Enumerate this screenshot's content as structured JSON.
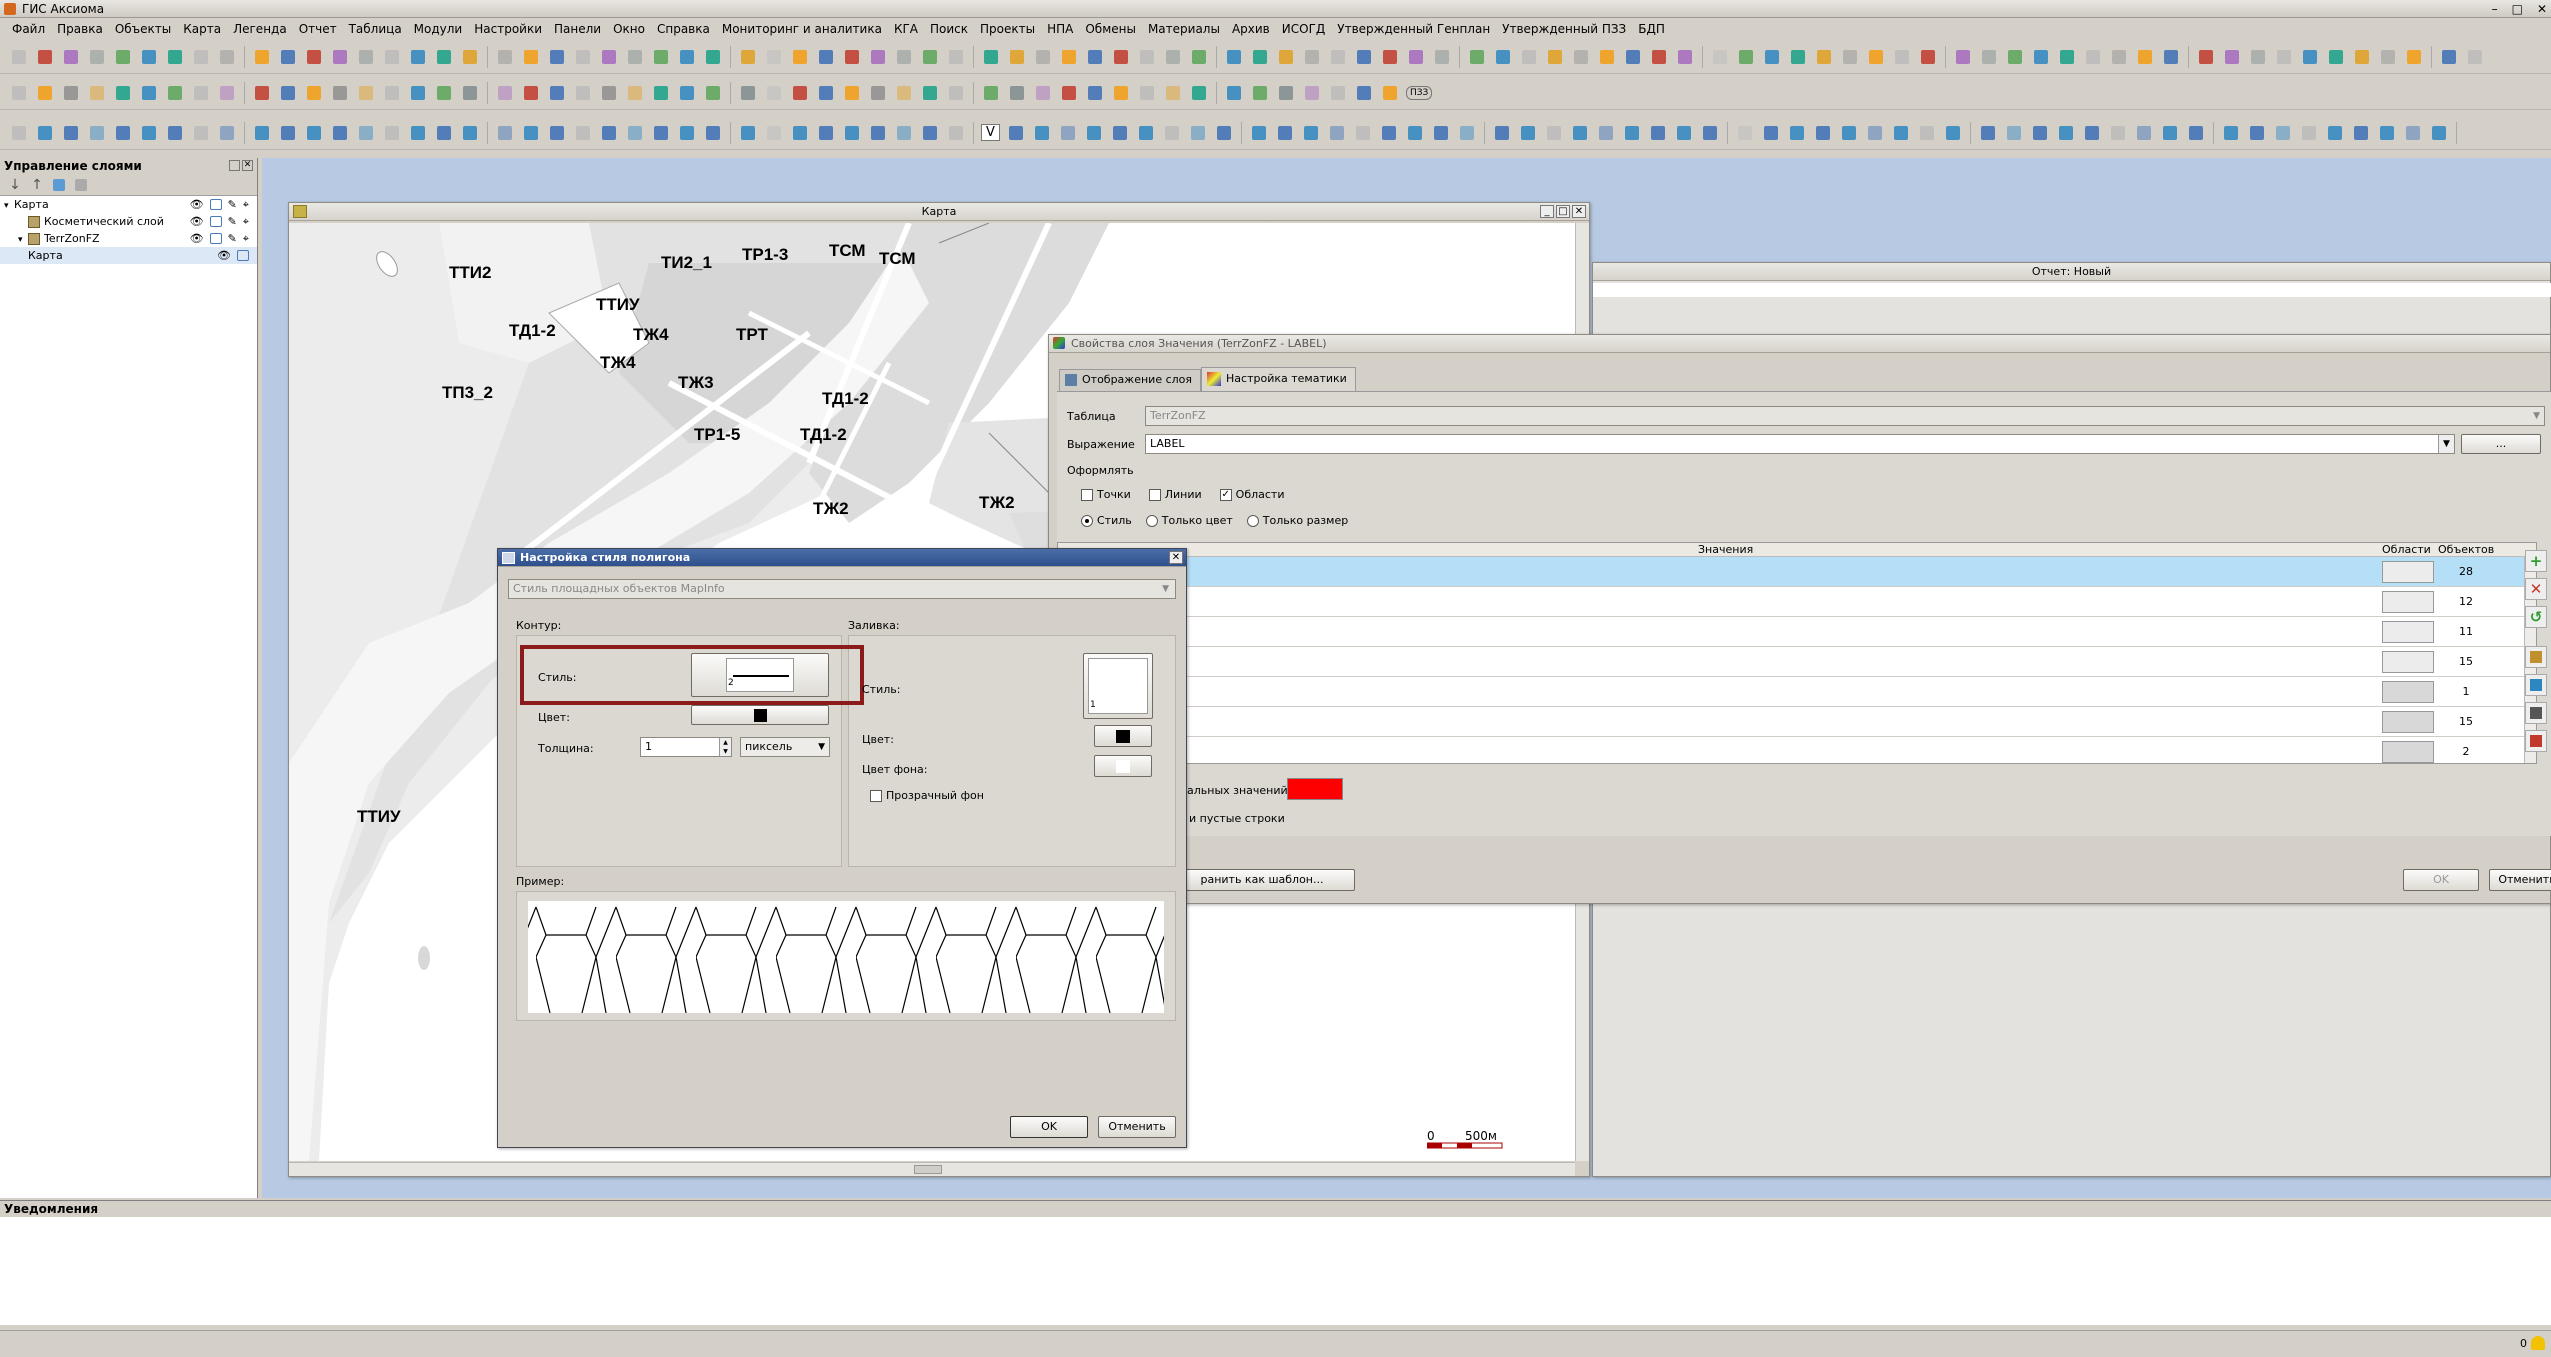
{
  "app": {
    "title": "ГИС Аксиома"
  },
  "menu": [
    "Файл",
    "Правка",
    "Объекты",
    "Карта",
    "Легенда",
    "Отчет",
    "Таблица",
    "Модули",
    "Настройки",
    "Панели",
    "Окно",
    "Справка",
    "Мониторинг и аналитика",
    "КГА",
    "Поиск",
    "Проекты",
    "НПА",
    "Обмены",
    "Материалы",
    "Архив",
    "ИСОГД",
    "Утвержденный Генплан",
    "Утвержденный ПЗЗ",
    "БДП"
  ],
  "toolbar3_text": {
    "pzz": "ПЗЗ",
    "v": "V"
  },
  "layers_panel": {
    "title": "Управление слоями",
    "items": [
      {
        "label": "Карта",
        "level": 0,
        "expand": "▾"
      },
      {
        "label": "Косметический слой",
        "level": 1,
        "expand": ""
      },
      {
        "label": "TerrZonFZ",
        "level": 1,
        "expand": "▾"
      },
      {
        "label": "Карта",
        "level": 1,
        "expand": ""
      }
    ]
  },
  "map_window": {
    "title": "Карта",
    "labels": [
      "ТТИ2",
      "ТИ2_1",
      "ТР1-3",
      "ТСМ",
      "ТСМ",
      "ТТИУ",
      "ТД1-2",
      "ТЖ4",
      "ТРТ",
      "ТЖ4",
      "ТЖ3",
      "ТП3_2",
      "ТД1-2",
      "ТР1-5",
      "ТД1-2",
      "ТЖ2",
      "ТЖ2",
      "ТТИУ"
    ],
    "scale": {
      "zero": "0",
      "distance": "500м"
    }
  },
  "report_window": {
    "title": "Отчет: Новый"
  },
  "layer_props": {
    "title": "Свойства слоя Значения (TerrZonFZ - LABEL)",
    "tabs": [
      "Отображение слоя",
      "Настройка тематики"
    ],
    "table_label": "Таблица",
    "table_value": "TerrZonFZ",
    "expr_label": "Выражение",
    "expr_value": "LABEL",
    "expr_more": "...",
    "style_group": "Оформлять",
    "checks": [
      {
        "label": "Точки",
        "checked": ""
      },
      {
        "label": "Линии",
        "checked": ""
      },
      {
        "label": "Области",
        "checked": "✓"
      }
    ],
    "radios": [
      {
        "label": "Стиль",
        "on": true
      },
      {
        "label": "Только цвет",
        "on": false
      },
      {
        "label": "Только размер",
        "on": false
      }
    ],
    "cols": {
      "values": "Значения",
      "areas": "Области",
      "objects": "Объектов"
    },
    "counts": [
      "28",
      "12",
      "11",
      "15",
      "1",
      "15",
      "2"
    ],
    "other_values_label": "альных значений",
    "empty_rows_label": "и пустые строки",
    "save_template": "ранить как шаблон...",
    "ok": "OK",
    "cancel": "Отменить",
    "accent_red": "#ff0000"
  },
  "polygon_dialog": {
    "title": "Настройка стиля полигона",
    "style_source": "Стиль площадных объектов MapInfo",
    "contour_label": "Контур:",
    "fill_label": "Заливка:",
    "style_label": "Стиль:",
    "style_num": "2",
    "fill_style_num": "1",
    "color_label": "Цвет:",
    "thickness_label": "Толщина:",
    "thickness_value": "1",
    "unit_value": "пиксель",
    "fill_color_label": "Цвет:",
    "bg_color_label": "Цвет фона:",
    "transparent_label": "Прозрачный фон",
    "sample_label": "Пример:",
    "ok": "OK",
    "cancel": "Отменить",
    "highlight_color": "#8b1a1a"
  },
  "notifications": {
    "title": "Уведомления"
  },
  "statusbar": {
    "count": "0"
  }
}
